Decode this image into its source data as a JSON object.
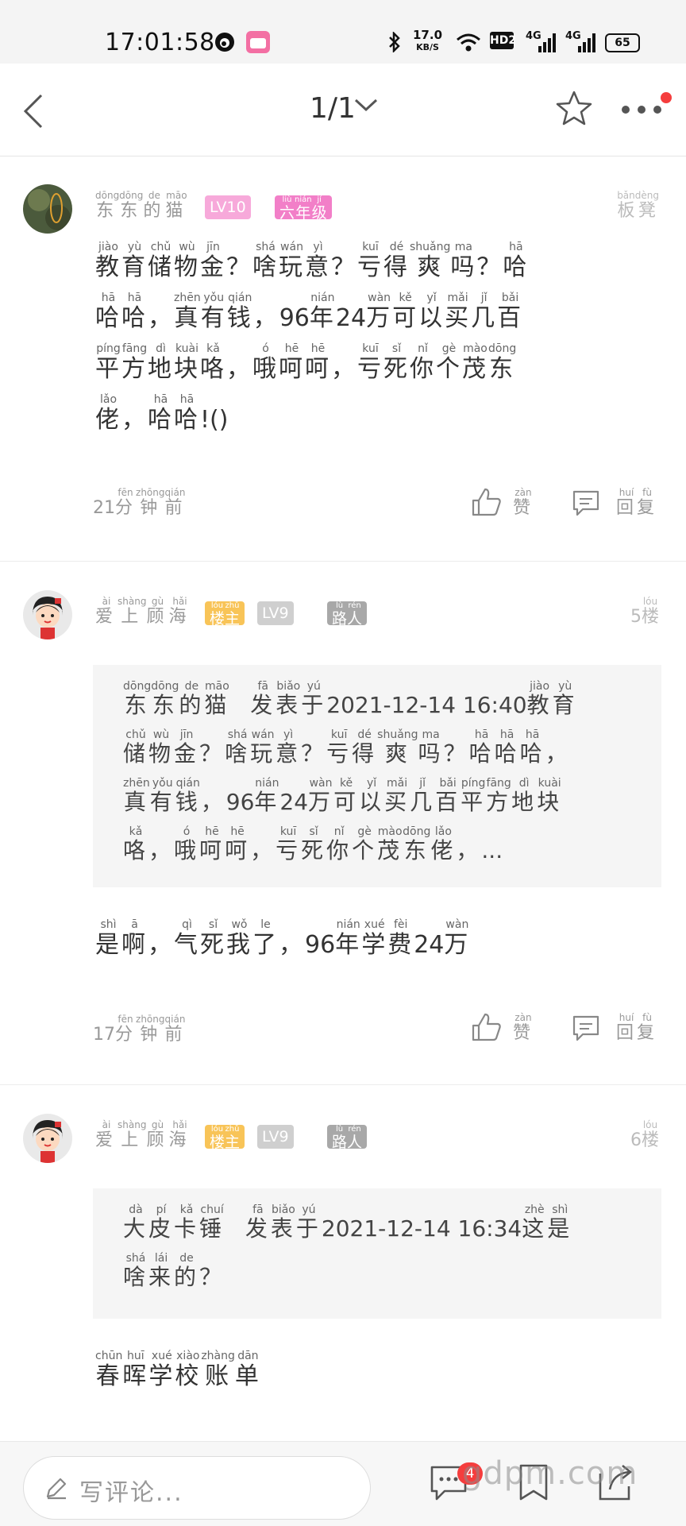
{
  "status_bar": {
    "time": "17:01:58",
    "speed_value": "17.0",
    "speed_unit": "KB/S",
    "hd_label": "HD2",
    "net1": "4G",
    "net2": "4G",
    "battery": "65",
    "icons": [
      "weibo-icon",
      "bilibili-icon",
      "bluetooth-icon",
      "wifi-icon",
      "signal-icon"
    ]
  },
  "nav": {
    "title": "1/1",
    "icons": [
      "back-icon",
      "chevron-down-icon",
      "star-icon",
      "more-icon"
    ]
  },
  "posts": [
    {
      "username": "东东的猫",
      "username_pinyin": [
        "dōng",
        "dōng",
        "de",
        "māo"
      ],
      "badges": [
        {
          "text": "LV10",
          "color": "#f7a9da"
        },
        {
          "text": "六年级",
          "pinyin": [
            "liù",
            "nián",
            "jí"
          ],
          "color": "#f27fc8"
        }
      ],
      "floor": "板凳",
      "floor_pinyin": [
        "bǎn",
        "dèng"
      ],
      "content_lines": [
        [
          [
            "教",
            "jiào"
          ],
          [
            "育",
            "yù"
          ],
          [
            "储",
            "chǔ"
          ],
          [
            "物",
            "wù"
          ],
          [
            "金",
            "jīn"
          ],
          [
            "？",
            ""
          ],
          [
            "啥",
            "shá"
          ],
          [
            "玩",
            "wán"
          ],
          [
            "意",
            "yì"
          ],
          [
            "？",
            ""
          ],
          [
            "亏",
            "kuī"
          ],
          [
            "得",
            "dé"
          ],
          [
            "爽",
            "shuǎng"
          ],
          [
            "吗",
            "ma"
          ],
          [
            "？",
            ""
          ],
          [
            "哈",
            "hā"
          ]
        ],
        [
          [
            "哈",
            "hā"
          ],
          [
            "哈",
            "hā"
          ],
          [
            "，",
            ""
          ],
          [
            "真",
            "zhēn"
          ],
          [
            "有",
            "yǒu"
          ],
          [
            "钱",
            "qián"
          ],
          [
            "，",
            ""
          ],
          [
            "96",
            ""
          ],
          [
            "年",
            "nián"
          ],
          [
            "24",
            ""
          ],
          [
            "万",
            "wàn"
          ],
          [
            "可",
            "kě"
          ],
          [
            "以",
            "yǐ"
          ],
          [
            "买",
            "mǎi"
          ],
          [
            "几",
            "jǐ"
          ],
          [
            "百",
            "bǎi"
          ]
        ],
        [
          [
            "平",
            "píng"
          ],
          [
            "方",
            "fāng"
          ],
          [
            "地",
            "dì"
          ],
          [
            "块",
            "kuài"
          ],
          [
            "咯",
            "kǎ"
          ],
          [
            "，",
            ""
          ],
          [
            "哦",
            "ó"
          ],
          [
            "呵",
            "hē"
          ],
          [
            "呵",
            "hē"
          ],
          [
            "，",
            ""
          ],
          [
            "亏",
            "kuī"
          ],
          [
            "死",
            "sǐ"
          ],
          [
            "你",
            "nǐ"
          ],
          [
            "个",
            "gè"
          ],
          [
            "茂",
            "mào"
          ],
          [
            "东",
            "dōng"
          ]
        ],
        [
          [
            "佬",
            "lǎo"
          ],
          [
            "，",
            ""
          ],
          [
            "哈",
            "hā"
          ],
          [
            "哈",
            "hā"
          ],
          [
            "!()",
            ""
          ]
        ]
      ],
      "time": "21分钟前",
      "time_pinyin": [
        "fēn",
        "zhōng",
        "qián"
      ],
      "like": "赞",
      "like_pinyin": [
        "zàn"
      ],
      "reply": "回复",
      "reply_pinyin": [
        "huí",
        "fù"
      ]
    },
    {
      "username": "爱上顾海",
      "username_pinyin": [
        "ài",
        "shàng",
        "gù",
        "hǎi"
      ],
      "badges": [
        {
          "text": "楼主",
          "pinyin": [
            "lóu",
            "zhǔ"
          ],
          "color": "#f8c458"
        },
        {
          "text": "LV9",
          "color": "#cfcfcf"
        },
        {
          "text": "路人",
          "pinyin": [
            "lù",
            "rén"
          ],
          "color": "#a8a8a8"
        }
      ],
      "floor": "5楼",
      "floor_pinyin": [
        "lóu"
      ],
      "quote_lines": [
        [
          [
            "东",
            "dōng"
          ],
          [
            "东",
            "dōng"
          ],
          [
            "的",
            "de"
          ],
          [
            "猫",
            "māo"
          ],
          [
            " ",
            ""
          ],
          [
            "发",
            "fā"
          ],
          [
            "表",
            "biǎo"
          ],
          [
            "于",
            "yú"
          ],
          [
            "2021-12-14 16:40",
            ""
          ],
          [
            "教",
            "jiào"
          ],
          [
            "育",
            "yù"
          ]
        ],
        [
          [
            "储",
            "chǔ"
          ],
          [
            "物",
            "wù"
          ],
          [
            "金",
            "jīn"
          ],
          [
            "？",
            ""
          ],
          [
            "啥",
            "shá"
          ],
          [
            "玩",
            "wán"
          ],
          [
            "意",
            "yì"
          ],
          [
            "？",
            ""
          ],
          [
            "亏",
            "kuī"
          ],
          [
            "得",
            "dé"
          ],
          [
            "爽",
            "shuǎng"
          ],
          [
            "吗",
            "ma"
          ],
          [
            "？",
            ""
          ],
          [
            "哈",
            "hā"
          ],
          [
            "哈",
            "hā"
          ],
          [
            "哈",
            "hā"
          ],
          [
            "，",
            ""
          ]
        ],
        [
          [
            "真",
            "zhēn"
          ],
          [
            "有",
            "yǒu"
          ],
          [
            "钱",
            "qián"
          ],
          [
            "，",
            ""
          ],
          [
            "96",
            ""
          ],
          [
            "年",
            "nián"
          ],
          [
            "24",
            ""
          ],
          [
            "万",
            "wàn"
          ],
          [
            "可",
            "kě"
          ],
          [
            "以",
            "yǐ"
          ],
          [
            "买",
            "mǎi"
          ],
          [
            "几",
            "jǐ"
          ],
          [
            "百",
            "bǎi"
          ],
          [
            "平",
            "píng"
          ],
          [
            "方",
            "fāng"
          ],
          [
            "地",
            "dì"
          ],
          [
            "块",
            "kuài"
          ]
        ],
        [
          [
            "咯",
            "kǎ"
          ],
          [
            "，",
            ""
          ],
          [
            "哦",
            "ó"
          ],
          [
            "呵",
            "hē"
          ],
          [
            "呵",
            "hē"
          ],
          [
            "，",
            ""
          ],
          [
            "亏",
            "kuī"
          ],
          [
            "死",
            "sǐ"
          ],
          [
            "你",
            "nǐ"
          ],
          [
            "个",
            "gè"
          ],
          [
            "茂",
            "mào"
          ],
          [
            "东",
            "dōng"
          ],
          [
            "佬",
            "lǎo"
          ],
          [
            "，",
            ""
          ],
          [
            "...",
            ""
          ]
        ]
      ],
      "content_lines": [
        [
          [
            "是",
            "shì"
          ],
          [
            "啊",
            "ā"
          ],
          [
            "，",
            ""
          ],
          [
            "气",
            "qì"
          ],
          [
            "死",
            "sǐ"
          ],
          [
            "我",
            "wǒ"
          ],
          [
            "了",
            "le"
          ],
          [
            "，",
            ""
          ],
          [
            "96",
            ""
          ],
          [
            "年",
            "nián"
          ],
          [
            "学",
            "xué"
          ],
          [
            "费",
            "fèi"
          ],
          [
            "24",
            ""
          ],
          [
            "万",
            "wàn"
          ]
        ]
      ],
      "time": "17分钟前",
      "time_pinyin": [
        "fēn",
        "zhōng",
        "qián"
      ],
      "like": "赞",
      "like_pinyin": [
        "zàn"
      ],
      "reply": "回复",
      "reply_pinyin": [
        "huí",
        "fù"
      ]
    },
    {
      "username": "爱上顾海",
      "username_pinyin": [
        "ài",
        "shàng",
        "gù",
        "hǎi"
      ],
      "badges": [
        {
          "text": "楼主",
          "pinyin": [
            "lóu",
            "zhǔ"
          ],
          "color": "#f8c458"
        },
        {
          "text": "LV9",
          "color": "#cfcfcf"
        },
        {
          "text": "路人",
          "pinyin": [
            "lù",
            "rén"
          ],
          "color": "#a8a8a8"
        }
      ],
      "floor": "6楼",
      "floor_pinyin": [
        "lóu"
      ],
      "quote_lines": [
        [
          [
            "大",
            "dà"
          ],
          [
            "皮",
            "pí"
          ],
          [
            "卡",
            "kǎ"
          ],
          [
            "锤",
            "chuí"
          ],
          [
            " ",
            ""
          ],
          [
            "发",
            "fā"
          ],
          [
            "表",
            "biǎo"
          ],
          [
            "于",
            "yú"
          ],
          [
            "2021-12-14 16:34",
            ""
          ],
          [
            "这",
            "zhè"
          ],
          [
            "是",
            "shì"
          ]
        ],
        [
          [
            "啥",
            "shá"
          ],
          [
            "来",
            "lái"
          ],
          [
            "的",
            "de"
          ],
          [
            "？",
            ""
          ]
        ]
      ],
      "content_lines": [
        [
          [
            "春",
            "chūn"
          ],
          [
            "晖",
            "huī"
          ],
          [
            "学",
            "xué"
          ],
          [
            "校",
            "xiào"
          ],
          [
            "账",
            "zhàng"
          ],
          [
            "单",
            "dān"
          ]
        ]
      ]
    }
  ],
  "bottom_bar": {
    "placeholder": "写评论...",
    "comment_count": "4",
    "icons": [
      "pencil-icon",
      "comment-icon",
      "bookmark-icon",
      "share-icon"
    ]
  },
  "watermark": "gdpm.com"
}
